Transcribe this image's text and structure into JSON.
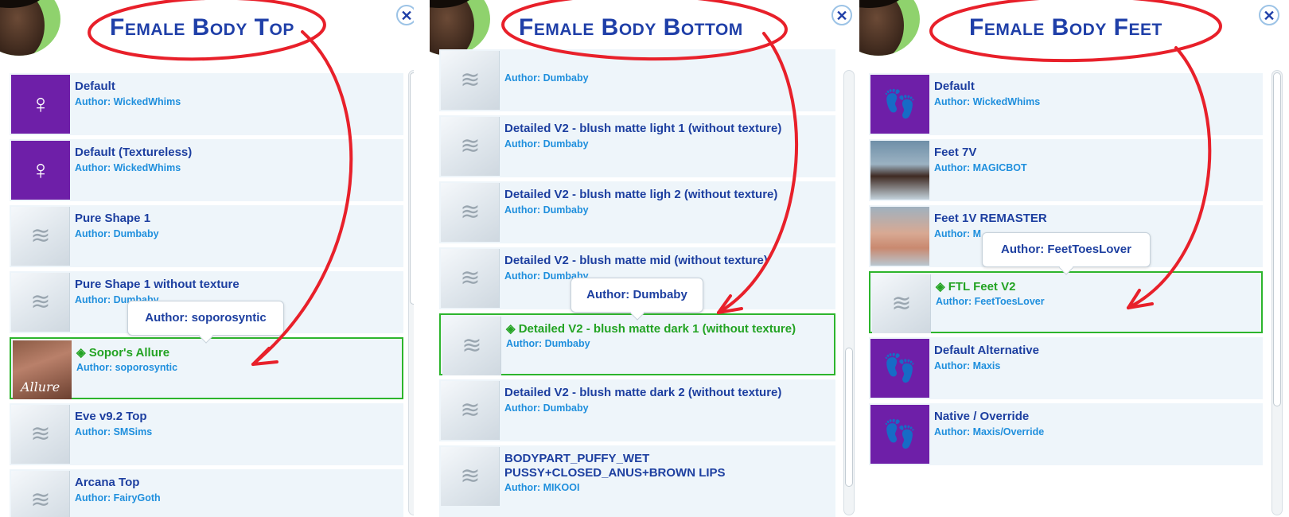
{
  "panels": [
    {
      "title": "Female Body Top",
      "close_glyph": "✕",
      "items": [
        {
          "name": "Default",
          "author": "Author: WickedWhims",
          "thumb": "purple-torso-icon"
        },
        {
          "name": "Default (Textureless)",
          "author": "Author: WickedWhims",
          "thumb": "purple-torso-icon"
        },
        {
          "name": "Pure Shape 1",
          "author": "Author: Dumbaby",
          "thumb": "cas-placeholder-icon"
        },
        {
          "name": "Pure Shape 1 without texture",
          "author": "Author: Dumbaby",
          "thumb": "cas-placeholder-icon"
        },
        {
          "name": "◈ Sopor's Allure",
          "author": "Author: soporosyntic",
          "thumb": "allure-photo",
          "thumb_text": "Allure",
          "selected": true
        },
        {
          "name": "Eve v9.2 Top",
          "author": "Author: SMSims",
          "thumb": "cas-placeholder-icon"
        },
        {
          "name": "Arcana Top",
          "author": "Author: FairyGoth",
          "thumb": "cas-placeholder-icon"
        }
      ],
      "tooltip": "Author: soporosyntic"
    },
    {
      "title": "Female Body Bottom",
      "close_glyph": "✕",
      "items": [
        {
          "name": "",
          "author": "Author: Dumbaby",
          "thumb": "cas-placeholder-icon"
        },
        {
          "name": "Detailed V2 - blush matte light 1 (without texture)",
          "author": "Author: Dumbaby",
          "thumb": "cas-placeholder-icon"
        },
        {
          "name": "Detailed V2 - blush matte ligh 2 (without texture)",
          "author": "Author: Dumbaby",
          "thumb": "cas-placeholder-icon"
        },
        {
          "name": "Detailed V2 - blush matte mid (without texture)",
          "author": "Author: Dumbaby",
          "thumb": "cas-placeholder-icon"
        },
        {
          "name": "◈ Detailed V2 - blush matte dark 1 (without texture)",
          "author": "Author: Dumbaby",
          "thumb": "cas-placeholder-icon",
          "selected": true
        },
        {
          "name": "Detailed V2 - blush matte dark 2 (without texture)",
          "author": "Author: Dumbaby",
          "thumb": "cas-placeholder-icon"
        },
        {
          "name": "BODYPART_PUFFY_WET PUSSY+CLOSED_ANUS+BROWN LIPS",
          "author": "Author: MIKOOI",
          "thumb": "cas-placeholder-icon"
        }
      ],
      "tooltip": "Author: Dumbaby"
    },
    {
      "title": "Female Body Feet",
      "close_glyph": "✕",
      "items": [
        {
          "name": "Default",
          "author": "Author: WickedWhims",
          "thumb": "purple-feet-icon"
        },
        {
          "name": "Feet 7V",
          "author": "Author: MAGICBOT",
          "thumb": "feet-photo"
        },
        {
          "name": "Feet 1V REMASTER",
          "author": "Author: M",
          "thumb": "feet-photo"
        },
        {
          "name": "◈ FTL Feet V2",
          "author": "Author: FeetToesLover",
          "thumb": "cas-placeholder-icon",
          "selected": true
        },
        {
          "name": "Default Alternative",
          "author": "Author: Maxis",
          "thumb": "purple-feet-icon"
        },
        {
          "name": "Native / Override",
          "author": "Author: Maxis/Override",
          "thumb": "purple-feet-icon"
        }
      ],
      "tooltip": "Author: FeetToesLover"
    }
  ],
  "colors": {
    "title": "#1f3fa8",
    "item_name": "#1d3fa0",
    "author": "#1f8fdd",
    "selected": "#2db52d",
    "annotation": "#e8202a",
    "row_bg": "#eef5fa"
  }
}
